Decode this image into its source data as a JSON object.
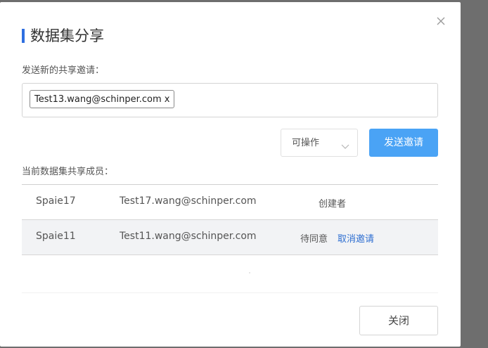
{
  "dialog": {
    "title": "数据集分享",
    "accent_color": "#2f6fe0"
  },
  "invite": {
    "label": "发送新的共享邀请：",
    "tags": [
      {
        "email": "Test13.wang@schinper.com",
        "remove": "x"
      }
    ],
    "permission": {
      "selected": "可操作",
      "icon": "chevron-down-icon"
    },
    "send_label": "发送邀请",
    "send_color": "#4aa3f5"
  },
  "members": {
    "label": "当前数据集共享成员：",
    "rows": [
      {
        "name": "Spaie17",
        "email": "Test17.wang@schinper.com",
        "status": "创建者",
        "action": ""
      },
      {
        "name": "Spaie11",
        "email": "Test11.wang@schinper.com",
        "status": "待同意",
        "action": "取消邀请"
      }
    ],
    "link_color": "#2f6fd1"
  },
  "footer": {
    "close_label": "关闭"
  }
}
